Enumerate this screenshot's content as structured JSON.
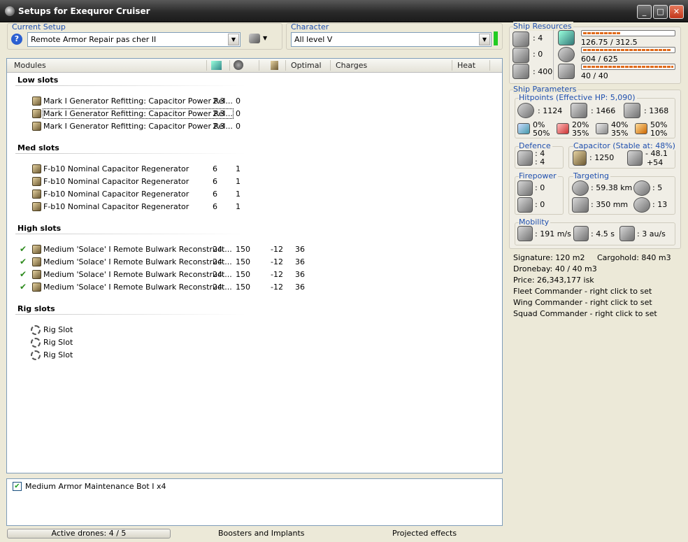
{
  "window": {
    "title": "Setups for Exequror Cruiser"
  },
  "setup": {
    "label": "Current Setup",
    "value": "Remote Armor Repair pas cher II"
  },
  "character": {
    "label": "Character",
    "value": "All level V"
  },
  "table": {
    "headers": {
      "modules": "Modules",
      "optimal": "Optimal",
      "charges": "Charges",
      "heat": "Heat"
    },
    "low_title": "Low slots",
    "low": [
      {
        "name": "Mark I Generator Refitting: Capacitor Power Rel...",
        "c1": "2.3",
        "c2": "0"
      },
      {
        "name": "Mark I Generator Refitting: Capacitor Power Rel...",
        "c1": "2.3",
        "c2": "0"
      },
      {
        "name": "Mark I Generator Refitting: Capacitor Power Rel...",
        "c1": "2.3",
        "c2": "0"
      }
    ],
    "med_title": "Med slots",
    "med": [
      {
        "name": "F-b10 Nominal Capacitor Regenerator",
        "c1": "6",
        "c2": "1"
      },
      {
        "name": "F-b10 Nominal Capacitor Regenerator",
        "c1": "6",
        "c2": "1"
      },
      {
        "name": "F-b10 Nominal Capacitor Regenerator",
        "c1": "6",
        "c2": "1"
      },
      {
        "name": "F-b10 Nominal Capacitor Regenerator",
        "c1": "6",
        "c2": "1"
      }
    ],
    "high_title": "High slots",
    "high": [
      {
        "name": "Medium 'Solace' I Remote Bulwark Reconstruct...",
        "c1": "24",
        "c2": "150",
        "c3": "-12",
        "c4": "36"
      },
      {
        "name": "Medium 'Solace' I Remote Bulwark Reconstruct...",
        "c1": "24",
        "c2": "150",
        "c3": "-12",
        "c4": "36"
      },
      {
        "name": "Medium 'Solace' I Remote Bulwark Reconstruct...",
        "c1": "24",
        "c2": "150",
        "c3": "-12",
        "c4": "36"
      },
      {
        "name": "Medium 'Solace' I Remote Bulwark Reconstruct...",
        "c1": "24",
        "c2": "150",
        "c3": "-12",
        "c4": "36"
      }
    ],
    "rig_title": "Rig slots",
    "rig": [
      {
        "name": "Rig Slot"
      },
      {
        "name": "Rig Slot"
      },
      {
        "name": "Rig Slot"
      }
    ]
  },
  "drones": {
    "item": "Medium Armor Maintenance Bot I x4",
    "checked": true
  },
  "resources": {
    "label": "Ship Resources",
    "turrets": ": 4",
    "launchers": ": 0",
    "drone_bw": ": 400",
    "cpu": "126.75 / 312.5",
    "cpu_fraction": 0.41,
    "power": "604 / 625",
    "power_fraction": 0.97,
    "bandwidth": "40 / 40",
    "bandwidth_fraction": 1.0
  },
  "params": {
    "label": "Ship Parameters",
    "hp_label": "Hitpoints (Effective HP: 5,090)",
    "shield": ": 1124",
    "armor": ": 1466",
    "structure": ": 1368",
    "res": [
      {
        "a": "0%",
        "b": "50%"
      },
      {
        "a": "20%",
        "b": "35%"
      },
      {
        "a": "40%",
        "b": "35%"
      },
      {
        "a": "50%",
        "b": "10%"
      }
    ],
    "defence_label": "Defence",
    "def1": ": 4",
    "def2": ": 4",
    "cap_label": "Capacitor (Stable at: 48%)",
    "cap": ": 1250",
    "cap_a": "- 48.1",
    "cap_b": "+54",
    "firepower_label": "Firepower",
    "fp1": ": 0",
    "fp2": ": 0",
    "targeting_label": "Targeting",
    "range": ": 59.38 km",
    "targets": ": 5",
    "scan_res": ": 350 mm",
    "sensor": ": 13",
    "mobility_label": "Mobility",
    "speed": ": 191 m/s",
    "align": ": 4.5 s",
    "warp": ": 3 au/s"
  },
  "info": {
    "signature": "Signature: 120 m2",
    "cargohold": "Cargohold: 840 m3",
    "dronebay": "Dronebay: 40 / 40 m3",
    "price": "Price: 26,343,177 isk",
    "fleet": "Fleet Commander - right click to set",
    "wing": "Wing Commander - right click to set",
    "squad": "Squad Commander - right click to set"
  },
  "status": {
    "drones": "Active drones: 4 / 5",
    "boosters": "Boosters and Implants",
    "projected": "Projected effects"
  }
}
